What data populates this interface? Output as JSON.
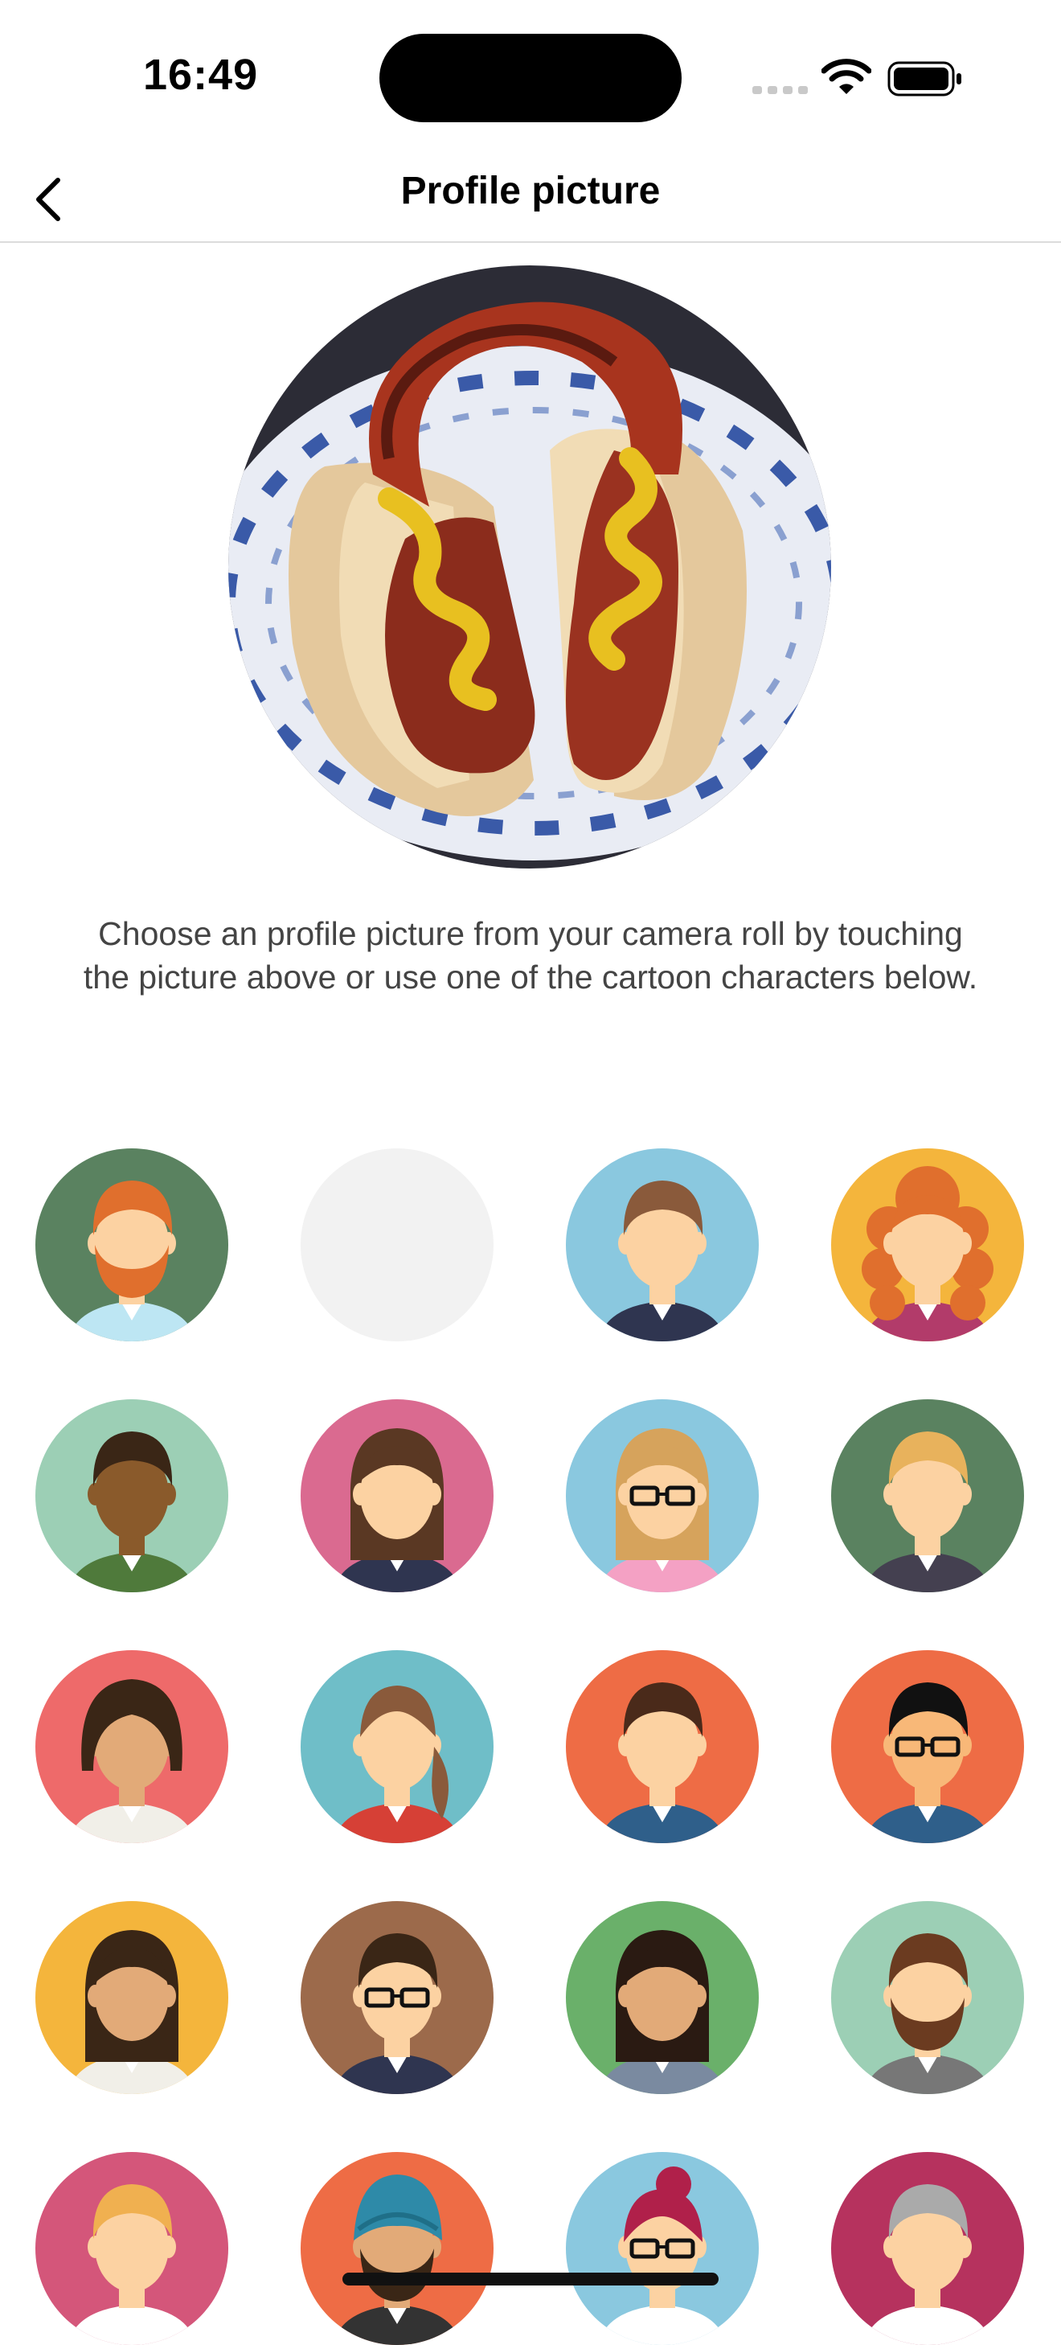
{
  "status": {
    "time": "16:49"
  },
  "nav": {
    "title": "Profile picture",
    "back_icon": "chevron-left-icon"
  },
  "profile_photo": {
    "subject": "hot-dog-photo"
  },
  "description": "Choose an profile picture from your camera roll by touching the picture above or use one of the cartoon characters below.",
  "colors": {
    "divider": "#dcdcdc",
    "placeholder": "#f2f2f2"
  },
  "avatars": [
    {
      "bg": "#5a8260",
      "skin": "#fcd2a2",
      "hair": "#e06f2d",
      "beard": "#e06f2d",
      "shirt": "#bde6f3",
      "hairStyle": "short",
      "beardOn": true,
      "glasses": false
    },
    {
      "bg": "#f2f2f2",
      "empty": true
    },
    {
      "bg": "#8ac8df",
      "skin": "#fcd2a2",
      "hair": "#8a5a3b",
      "shirt": "#2f3550",
      "hairStyle": "short",
      "beardOn": false,
      "glasses": false
    },
    {
      "bg": "#f4b53c",
      "skin": "#fcd2a2",
      "hair": "#e06f2d",
      "shirt": "#b23b6a",
      "hairStyle": "curly",
      "beardOn": false,
      "glasses": false
    },
    {
      "bg": "#9ccfb5",
      "skin": "#8a5a2b",
      "hair": "#3a2616",
      "shirt": "#4f7a3b",
      "hairStyle": "short",
      "beardOn": false,
      "glasses": false
    },
    {
      "bg": "#da6a90",
      "skin": "#fcd2a2",
      "hair": "#5a3823",
      "shirt": "#2f3550",
      "hairStyle": "long",
      "beardOn": false,
      "glasses": false
    },
    {
      "bg": "#8ac8df",
      "skin": "#fcd2a2",
      "hair": "#d6a35c",
      "shirt": "#f4a1c4",
      "hairStyle": "long",
      "beardOn": false,
      "glasses": true
    },
    {
      "bg": "#5a8260",
      "skin": "#fcd2a2",
      "hair": "#e8b25c",
      "shirt": "#444050",
      "hairStyle": "short",
      "beardOn": false,
      "glasses": false
    },
    {
      "bg": "#ee6a6a",
      "skin": "#e2aa78",
      "hair": "#3a2616",
      "shirt": "#f1efe8",
      "hairStyle": "bob",
      "beardOn": false,
      "glasses": false
    },
    {
      "bg": "#6fbec8",
      "skin": "#fcd2a2",
      "hair": "#8a5a3b",
      "shirt": "#d64036",
      "hairStyle": "ponytail",
      "beardOn": false,
      "glasses": false
    },
    {
      "bg": "#ee6c45",
      "skin": "#fcd2a2",
      "hair": "#4a2a1a",
      "shirt": "#2f5f8a",
      "hairStyle": "short",
      "beardOn": false,
      "glasses": false
    },
    {
      "bg": "#ee6c45",
      "skin": "#f8b878",
      "hair": "#111111",
      "shirt": "#2f5f8a",
      "hairStyle": "short",
      "beardOn": false,
      "glasses": true
    },
    {
      "bg": "#f4b53c",
      "skin": "#e2aa78",
      "hair": "#3a2616",
      "shirt": "#f1efe8",
      "hairStyle": "long",
      "beardOn": false,
      "glasses": false
    },
    {
      "bg": "#9c6a4b",
      "skin": "#fcd2a2",
      "hair": "#3a2616",
      "shirt": "#2f3550",
      "hairStyle": "short",
      "beardOn": false,
      "glasses": true
    },
    {
      "bg": "#6ab06a",
      "skin": "#e2aa78",
      "hair": "#2a1a12",
      "shirt": "#7a8aa0",
      "hairStyle": "long",
      "beardOn": false,
      "glasses": false
    },
    {
      "bg": "#9ccfb5",
      "skin": "#fcd2a2",
      "hair": "#6b3b20",
      "beard": "#6b3b20",
      "shirt": "#777777",
      "hairStyle": "short",
      "beardOn": true,
      "glasses": false
    },
    {
      "bg": "#d4567a",
      "skin": "#fcd2a2",
      "hair": "#f0b050",
      "shirt": "#ffffff",
      "hairStyle": "short",
      "beardOn": false,
      "glasses": false
    },
    {
      "bg": "#ee6c45",
      "skin": "#e2aa78",
      "hair": "#2e8aa8",
      "shirt": "#333333",
      "hairStyle": "turban",
      "beardOn": true,
      "beard": "#3a2616",
      "glasses": false
    },
    {
      "bg": "#8ac8df",
      "skin": "#fcd2a2",
      "hair": "#b0204a",
      "shirt": "#ffffff",
      "hairStyle": "bun",
      "beardOn": false,
      "glasses": true
    },
    {
      "bg": "#b6325e",
      "skin": "#fcd2a2",
      "hair": "#aaaaaa",
      "shirt": "#ffffff",
      "hairStyle": "short",
      "beardOn": false,
      "glasses": false
    }
  ]
}
